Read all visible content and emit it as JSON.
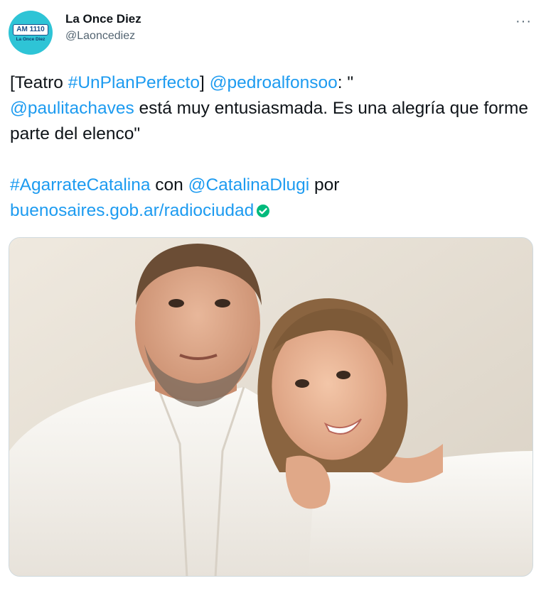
{
  "author": {
    "display_name": "La Once Diez",
    "handle": "@Laoncediez",
    "avatar_badge": "AM 1110",
    "avatar_sub": "La Once Diez"
  },
  "more_label": "···",
  "tweet": {
    "line1_prefix": "[Teatro ",
    "hashtag1": "#UnPlanPerfecto",
    "line1_mid": "] ",
    "mention1": "@pedroalfonsoo",
    "line1_suffix": ": \"",
    "mention2": "@paulitachaves",
    "quote_rest": " está muy entusiasmada. Es una alegría que forme parte del elenco\"",
    "hashtag2": "#AgarrateCatalina",
    "con": " con ",
    "mention3": "@CatalinaDlugi",
    "por": " por",
    "url": "buenosaires.gob.ar/radiociudad"
  },
  "colors": {
    "link": "#1d9bf0",
    "verified": "#00ba7c",
    "avatar_bg": "#2ec4d6"
  },
  "icons": {
    "verified": "verified-check-icon",
    "more": "more-options-icon"
  }
}
